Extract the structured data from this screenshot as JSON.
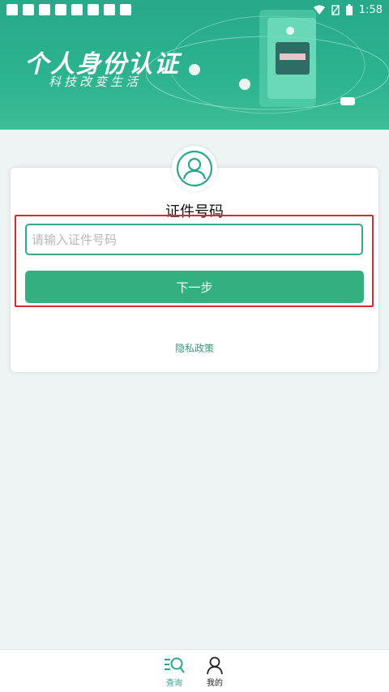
{
  "status_bar": {
    "time": "1:58",
    "notification_icon_count": 8,
    "icons": [
      "wifi-icon",
      "sim-icon",
      "battery-icon"
    ]
  },
  "banner": {
    "title": "个人身份认证",
    "subtitle": "科技改变生活"
  },
  "form": {
    "title": "证件号码",
    "input_placeholder": "请输入证件号码",
    "input_value": "",
    "next_button_label": "下一步",
    "privacy_link": "隐私政策"
  },
  "bottom_nav": {
    "items": [
      {
        "label": "查询",
        "icon": "search-list-icon",
        "active": true
      },
      {
        "label": "我的",
        "icon": "person-icon",
        "active": false
      }
    ]
  },
  "colors": {
    "accent": "#33b07f",
    "banner": "#2cb38f",
    "highlight_border": "#e3262b",
    "background": "#eef3f3"
  }
}
